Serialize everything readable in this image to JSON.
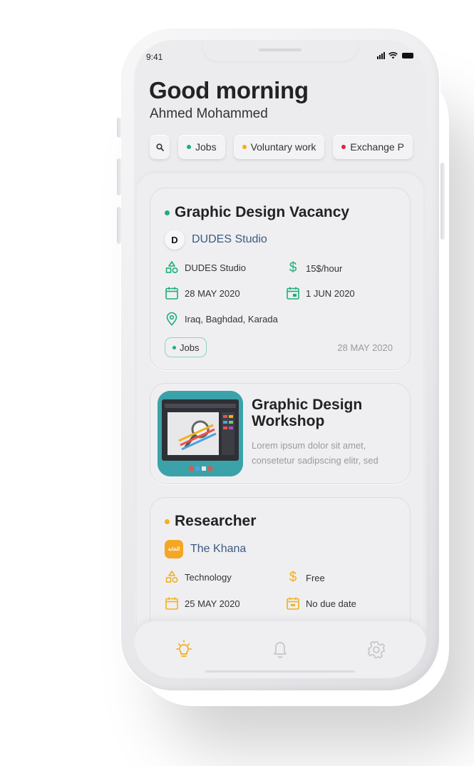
{
  "status_bar": {
    "time": "9:41"
  },
  "header": {
    "greeting": "Good morning",
    "username": "Ahmed Mohammed"
  },
  "filters": [
    {
      "label": "Jobs",
      "dot_color": "#1fae78"
    },
    {
      "label": "Voluntary work",
      "dot_color": "#f2b01e"
    },
    {
      "label": "Exchange P",
      "dot_color": "#e0243a"
    }
  ],
  "cards": {
    "vacancy": {
      "title": "Graphic Design Vacancy",
      "dot_color": "#1fae78",
      "company": "DUDES Studio",
      "company_logo_letter": "D",
      "organization": "DUDES Studio",
      "rate": "15$/hour",
      "start_date": "28 MAY 2020",
      "end_date": "1 JUN 2020",
      "location": "Iraq, Baghdad, Karada",
      "tag": "Jobs",
      "posted_date": "28 MAY 2020",
      "icon_color": "#1fae78"
    },
    "workshop": {
      "title_line1": "Graphic Design",
      "title_line2": "Workshop",
      "desc_line1": "Lorem ipsum dolor sit amet,",
      "desc_line2": "consetetur sadipscing elitr, sed"
    },
    "researcher": {
      "title": "Researcher",
      "dot_color": "#f2b01e",
      "company": "The Khana",
      "company_logo_text": "الخانة",
      "field": "Technology",
      "rate": "Free",
      "start_date": "25 MAY 2020",
      "end_date": "No due date",
      "icon_color": "#f2b01e"
    }
  },
  "bottom_nav": {
    "items": [
      {
        "icon": "lightbulb-icon",
        "active": true
      },
      {
        "icon": "bell-icon",
        "active": false
      },
      {
        "icon": "gear-icon",
        "active": false
      }
    ],
    "active_color": "#f2b01e",
    "inactive_color": "#c5c5ca"
  }
}
